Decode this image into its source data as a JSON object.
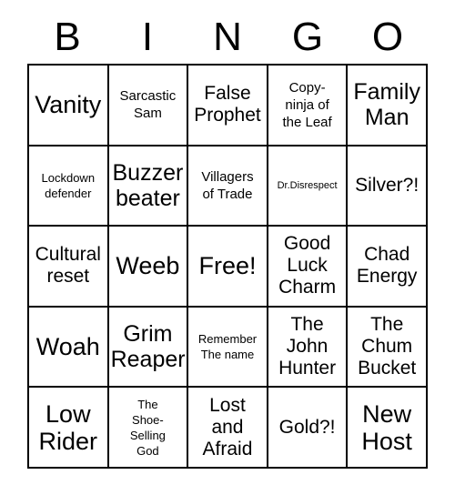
{
  "card": {
    "title": "BINGO",
    "header_letters": [
      "B",
      "I",
      "N",
      "G",
      "O"
    ],
    "free_space_label": "Free!",
    "columns": 5,
    "rows": 5,
    "colors": {
      "background": "#ffffff",
      "grid_line": "#000000",
      "text": "#000000"
    },
    "cells": [
      [
        {
          "text": "Vanity",
          "size": "xl"
        },
        {
          "text": "Sarcastic\nSam",
          "size": "sm"
        },
        {
          "text": "False\nProphet",
          "size": "md"
        },
        {
          "text": "Copy-\nninja of\nthe Leaf",
          "size": "sm"
        },
        {
          "text": "Family\nMan",
          "size": "lg"
        }
      ],
      [
        {
          "text": "Lockdown\ndefender",
          "size": "xs"
        },
        {
          "text": "Buzzer\nbeater",
          "size": "lg"
        },
        {
          "text": "Villagers\nof Trade",
          "size": "sm"
        },
        {
          "text": "Dr.Disrespect",
          "size": "xxs"
        },
        {
          "text": "Silver?!",
          "size": "md"
        }
      ],
      [
        {
          "text": "Cultural\nreset",
          "size": "md"
        },
        {
          "text": "Weeb",
          "size": "xl"
        },
        {
          "text": "Free!",
          "size": "xl"
        },
        {
          "text": "Good\nLuck\nCharm",
          "size": "md"
        },
        {
          "text": "Chad\nEnergy",
          "size": "md"
        }
      ],
      [
        {
          "text": "Woah",
          "size": "xl"
        },
        {
          "text": "Grim\nReaper",
          "size": "lg"
        },
        {
          "text": "Remember\nThe name",
          "size": "xs"
        },
        {
          "text": "The\nJohn\nHunter",
          "size": "md"
        },
        {
          "text": "The\nChum\nBucket",
          "size": "md"
        }
      ],
      [
        {
          "text": "Low\nRider",
          "size": "xl"
        },
        {
          "text": "The\nShoe-\nSelling\nGod",
          "size": "xs"
        },
        {
          "text": "Lost\nand\nAfraid",
          "size": "md"
        },
        {
          "text": "Gold?!",
          "size": "md"
        },
        {
          "text": "New\nHost",
          "size": "xl"
        }
      ]
    ]
  }
}
